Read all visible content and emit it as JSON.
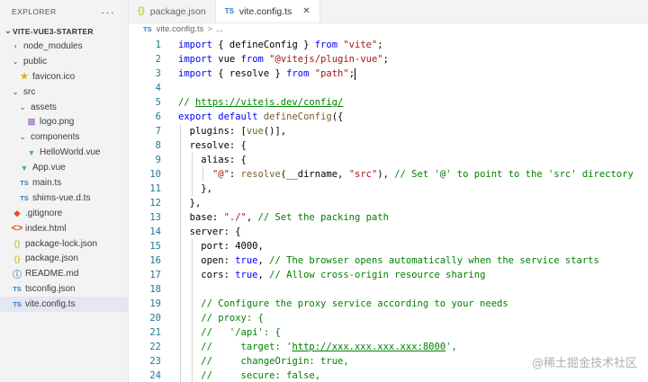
{
  "explorer": {
    "title": "EXPLORER",
    "more": "···",
    "root": "VITE-VUE3-STARTER",
    "items": [
      {
        "label": "node_modules",
        "kind": "folder",
        "expanded": false,
        "depth": 1,
        "icon": "chevron-right"
      },
      {
        "label": "public",
        "kind": "folder",
        "expanded": true,
        "depth": 1,
        "icon": "chevron-down"
      },
      {
        "label": "favicon.ico",
        "kind": "file",
        "depth": 2,
        "icon": "star-icon",
        "glyph": "★",
        "cls": "star"
      },
      {
        "label": "src",
        "kind": "folder",
        "expanded": true,
        "depth": 1,
        "icon": "chevron-down"
      },
      {
        "label": "assets",
        "kind": "folder",
        "expanded": true,
        "depth": 2,
        "icon": "chevron-down"
      },
      {
        "label": "logo.png",
        "kind": "file",
        "depth": 3,
        "icon": "image-icon",
        "glyph": "▨",
        "cls": "img"
      },
      {
        "label": "components",
        "kind": "folder",
        "expanded": true,
        "depth": 2,
        "icon": "chevron-down"
      },
      {
        "label": "HelloWorld.vue",
        "kind": "file",
        "depth": 3,
        "icon": "vue-icon",
        "glyph": "▼",
        "cls": "vue"
      },
      {
        "label": "App.vue",
        "kind": "file",
        "depth": 2,
        "icon": "vue-icon",
        "glyph": "▼",
        "cls": "vue"
      },
      {
        "label": "main.ts",
        "kind": "file",
        "depth": 2,
        "icon": "typescript-icon",
        "glyph": "TS",
        "cls": "ts"
      },
      {
        "label": "shims-vue.d.ts",
        "kind": "file",
        "depth": 2,
        "icon": "typescript-icon",
        "glyph": "TS",
        "cls": "ts"
      },
      {
        "label": ".gitignore",
        "kind": "file",
        "depth": 1,
        "icon": "git-icon",
        "glyph": "◆",
        "cls": "git"
      },
      {
        "label": "index.html",
        "kind": "file",
        "depth": 1,
        "icon": "html-icon",
        "glyph": "<>",
        "cls": "html"
      },
      {
        "label": "package-lock.json",
        "kind": "file",
        "depth": 1,
        "icon": "json-icon",
        "glyph": "{}",
        "cls": "json"
      },
      {
        "label": "package.json",
        "kind": "file",
        "depth": 1,
        "icon": "json-icon",
        "glyph": "{}",
        "cls": "json"
      },
      {
        "label": "README.md",
        "kind": "file",
        "depth": 1,
        "icon": "info-icon",
        "glyph": "ⓘ",
        "cls": "md"
      },
      {
        "label": "tsconfig.json",
        "kind": "file",
        "depth": 1,
        "icon": "typescript-config-icon",
        "glyph": "TS",
        "cls": "ts"
      },
      {
        "label": "vite.config.ts",
        "kind": "file",
        "depth": 1,
        "icon": "typescript-icon",
        "glyph": "TS",
        "cls": "ts",
        "selected": true
      }
    ]
  },
  "tabs": [
    {
      "label": "package.json",
      "icon": "json-icon",
      "glyph": "{}",
      "active": false
    },
    {
      "label": "vite.config.ts",
      "icon": "typescript-icon",
      "glyph": "TS",
      "active": true,
      "close": "✕"
    }
  ],
  "breadcrumb": {
    "icon": "TS",
    "file": "vite.config.ts",
    "separator": ">",
    "tail": "..."
  },
  "code_lines": [
    "import { defineConfig } from \"vite\";",
    "import vue from \"@vitejs/plugin-vue\";",
    "import { resolve } from \"path\";",
    "",
    "// https://vitejs.dev/config/",
    "export default defineConfig({",
    "  plugins: [vue()],",
    "  resolve: {",
    "    alias: {",
    "      \"@\": resolve(__dirname, \"src\"), // Set '@' to point to the 'src' directory",
    "    },",
    "  },",
    "  base: \"./\", // Set the packing path",
    "  server: {",
    "    port: 4000,",
    "    open: true, // The browser opens automatically when the service starts",
    "    cors: true, // Allow cross-origin resource sharing",
    "",
    "    // Configure the proxy service according to your needs",
    "    // proxy: {",
    "    //   '/api': {",
    "    //     target: 'http://xxx.xxx.xxx.xxx:8000',",
    "    //     changeOrigin: true,",
    "    //     secure: false,"
  ],
  "watermark": "@稀土掘金技术社区",
  "colors": {
    "keyword": "#0000ff",
    "string": "#a31515",
    "comment": "#008000",
    "line_number": "#237893",
    "selection": "#e4e6f1"
  }
}
